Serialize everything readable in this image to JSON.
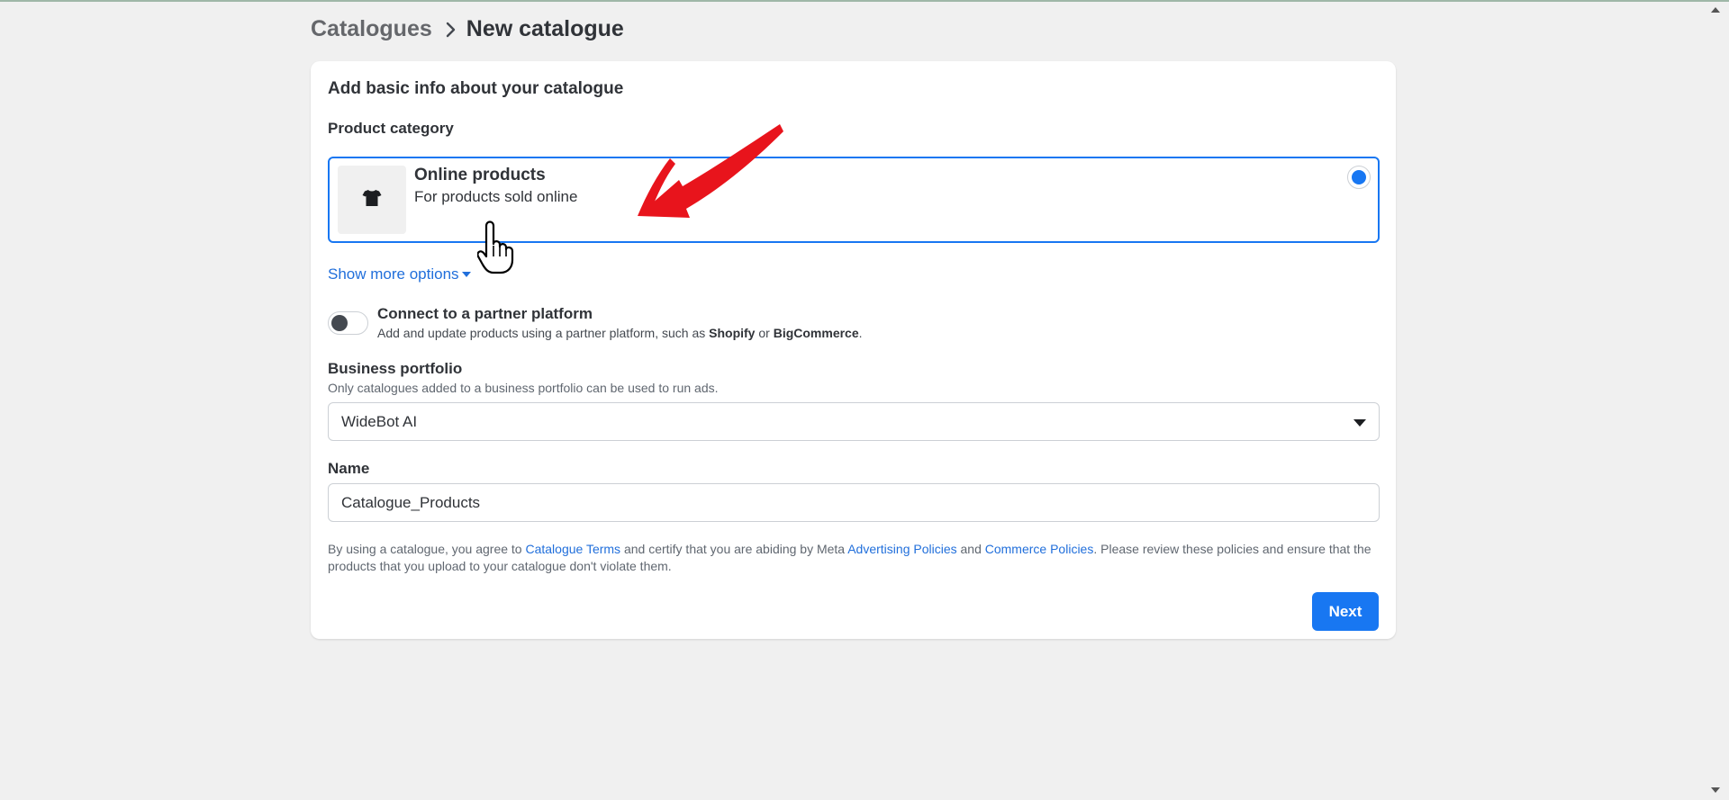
{
  "breadcrumb": {
    "parent": "Catalogues",
    "current": "New catalogue"
  },
  "card": {
    "title": "Add basic info about your catalogue",
    "product_category_label": "Product category",
    "option": {
      "title": "Online products",
      "description": "For products sold online",
      "icon": "tshirt-icon",
      "selected": true
    },
    "show_more": "Show more options",
    "partner": {
      "title": "Connect to a partner platform",
      "desc_prefix": "Add and update products using a partner platform, such as ",
      "shopify": "Shopify",
      "or": " or ",
      "bigcommerce": "BigCommerce",
      "desc_suffix": ".",
      "enabled": false
    },
    "business_portfolio": {
      "label": "Business portfolio",
      "help": "Only catalogues added to a business portfolio can be used to run ads.",
      "selected": "WideBot AI"
    },
    "name": {
      "label": "Name",
      "value": "Catalogue_Products"
    },
    "terms": {
      "t1": "By using a catalogue, you agree to ",
      "link1": "Catalogue Terms",
      "t2": " and certify that you are abiding by Meta ",
      "link2": "Advertising Policies",
      "t3": " and ",
      "link3": "Commerce Policies",
      "t4": ". Please review these policies and ensure that the products that you upload to your catalogue don't violate them."
    },
    "next_label": "Next"
  },
  "colors": {
    "accent": "#1877f2",
    "link": "#216fdb",
    "annotation": "#e8141c",
    "background": "#f0f0f0"
  }
}
